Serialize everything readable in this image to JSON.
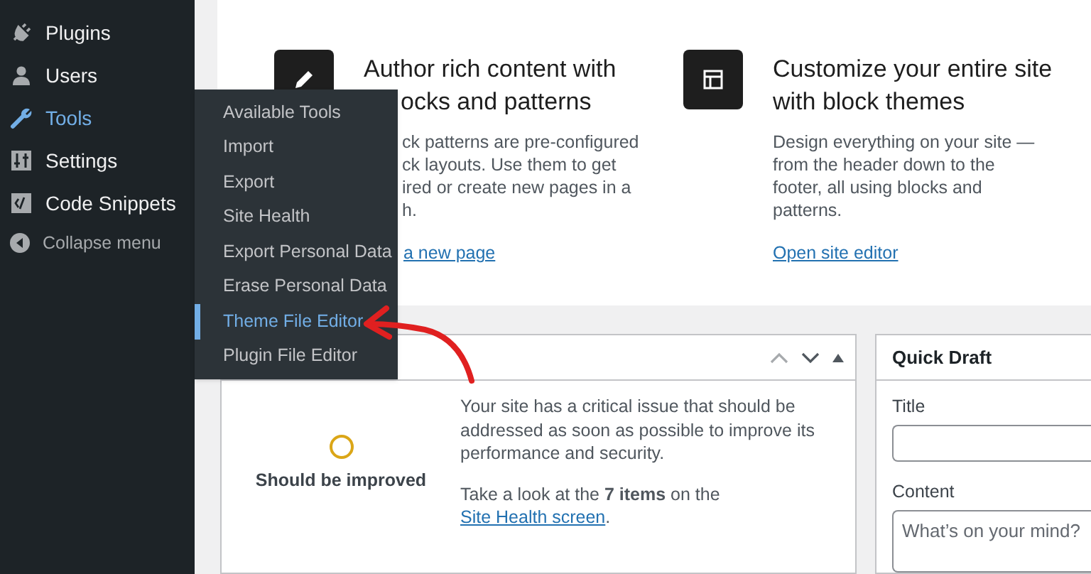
{
  "sidebar": {
    "items": [
      {
        "label": "Plugins",
        "kind": "menu",
        "selected": false
      },
      {
        "label": "Users",
        "kind": "menu",
        "selected": false
      },
      {
        "label": "Tools",
        "kind": "menu",
        "selected": true
      },
      {
        "label": "Settings",
        "kind": "menu",
        "selected": false
      },
      {
        "label": "Code Snippets",
        "kind": "menu",
        "selected": false
      },
      {
        "label": "Collapse menu",
        "kind": "collapse",
        "selected": false
      }
    ]
  },
  "flyout": {
    "items": [
      {
        "label": "Available Tools",
        "selected": false
      },
      {
        "label": "Import",
        "selected": false
      },
      {
        "label": "Export",
        "selected": false
      },
      {
        "label": "Site Health",
        "selected": false
      },
      {
        "label": "Export Personal Data",
        "selected": false
      },
      {
        "label": "Erase Personal Data",
        "selected": false
      },
      {
        "label": "Theme File Editor",
        "selected": true
      },
      {
        "label": "Plugin File Editor",
        "selected": false
      }
    ]
  },
  "welcome": {
    "cards": [
      {
        "title_lines": [
          "Author rich content with",
          "ocks and patterns"
        ],
        "description_lines": [
          "ck patterns are pre-configured",
          "ck layouts. Use them to get",
          "ired or create new pages in a",
          "h."
        ],
        "link": "a new page",
        "covered": true
      },
      {
        "title_lines": [
          "Customize your entire site",
          "with block themes"
        ],
        "description_lines": [
          "Design everything on your site —",
          "from the header down to the",
          "footer, all using blocks and",
          "patterns."
        ],
        "link": "Open site editor",
        "covered": false
      }
    ]
  },
  "site_health": {
    "status": "Should be improved",
    "message": "Your site has a critical issue that should be addressed as soon as possible to improve its performance and security.",
    "prompt": "Take a look at the **7 items** on the",
    "link": "Site Health screen",
    "end": "."
  },
  "quick_draft": {
    "title": "Quick Draft",
    "fields": [
      {
        "label": "Title",
        "kind": "input"
      },
      {
        "label": "Content",
        "kind": "textarea",
        "placeholder": "What’s on your mind?"
      }
    ]
  }
}
